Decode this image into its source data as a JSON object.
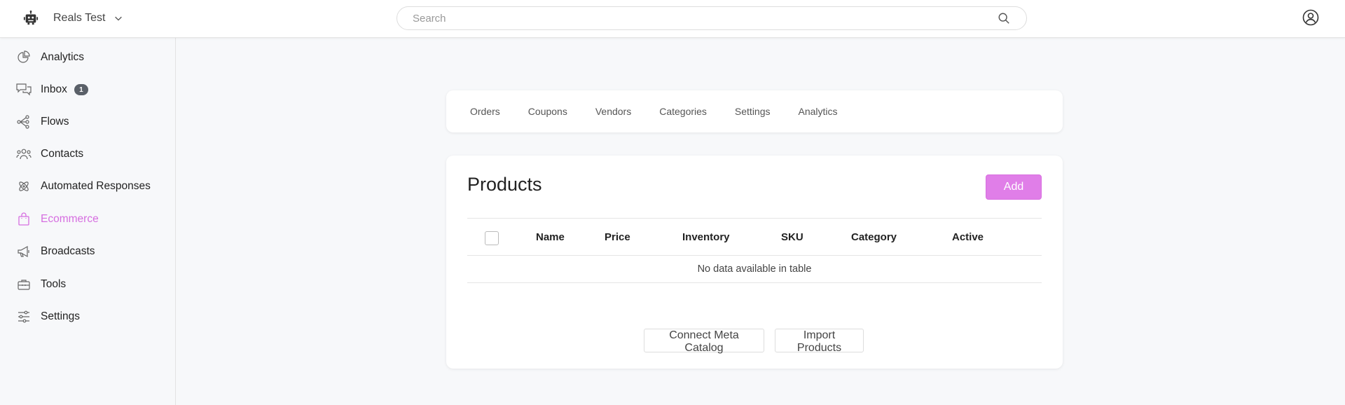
{
  "header": {
    "workspace_name": "Reals Test",
    "search_placeholder": "Search"
  },
  "sidebar": {
    "items": [
      {
        "label": "Analytics",
        "icon": "pie-chart-icon"
      },
      {
        "label": "Inbox",
        "icon": "chat-icon",
        "badge": "1"
      },
      {
        "label": "Flows",
        "icon": "flow-icon"
      },
      {
        "label": "Contacts",
        "icon": "users-icon"
      },
      {
        "label": "Automated Responses",
        "icon": "atom-icon"
      },
      {
        "label": "Ecommerce",
        "icon": "shopping-bag-icon",
        "active": true
      },
      {
        "label": "Broadcasts",
        "icon": "megaphone-icon"
      },
      {
        "label": "Tools",
        "icon": "toolbox-icon"
      },
      {
        "label": "Settings",
        "icon": "sliders-icon"
      }
    ]
  },
  "tabs": [
    "Orders",
    "Coupons",
    "Vendors",
    "Categories",
    "Settings",
    "Analytics"
  ],
  "products": {
    "title": "Products",
    "add_label": "Add",
    "columns": [
      "Name",
      "Price",
      "Inventory",
      "SKU",
      "Category",
      "Active"
    ],
    "empty_message": "No data available in table",
    "connect_label": "Connect Meta Catalog",
    "import_label": "Import Products"
  },
  "colors": {
    "accent": "#e07ee8",
    "active_nav": "#d66ee0",
    "badge": "#5a6068"
  }
}
